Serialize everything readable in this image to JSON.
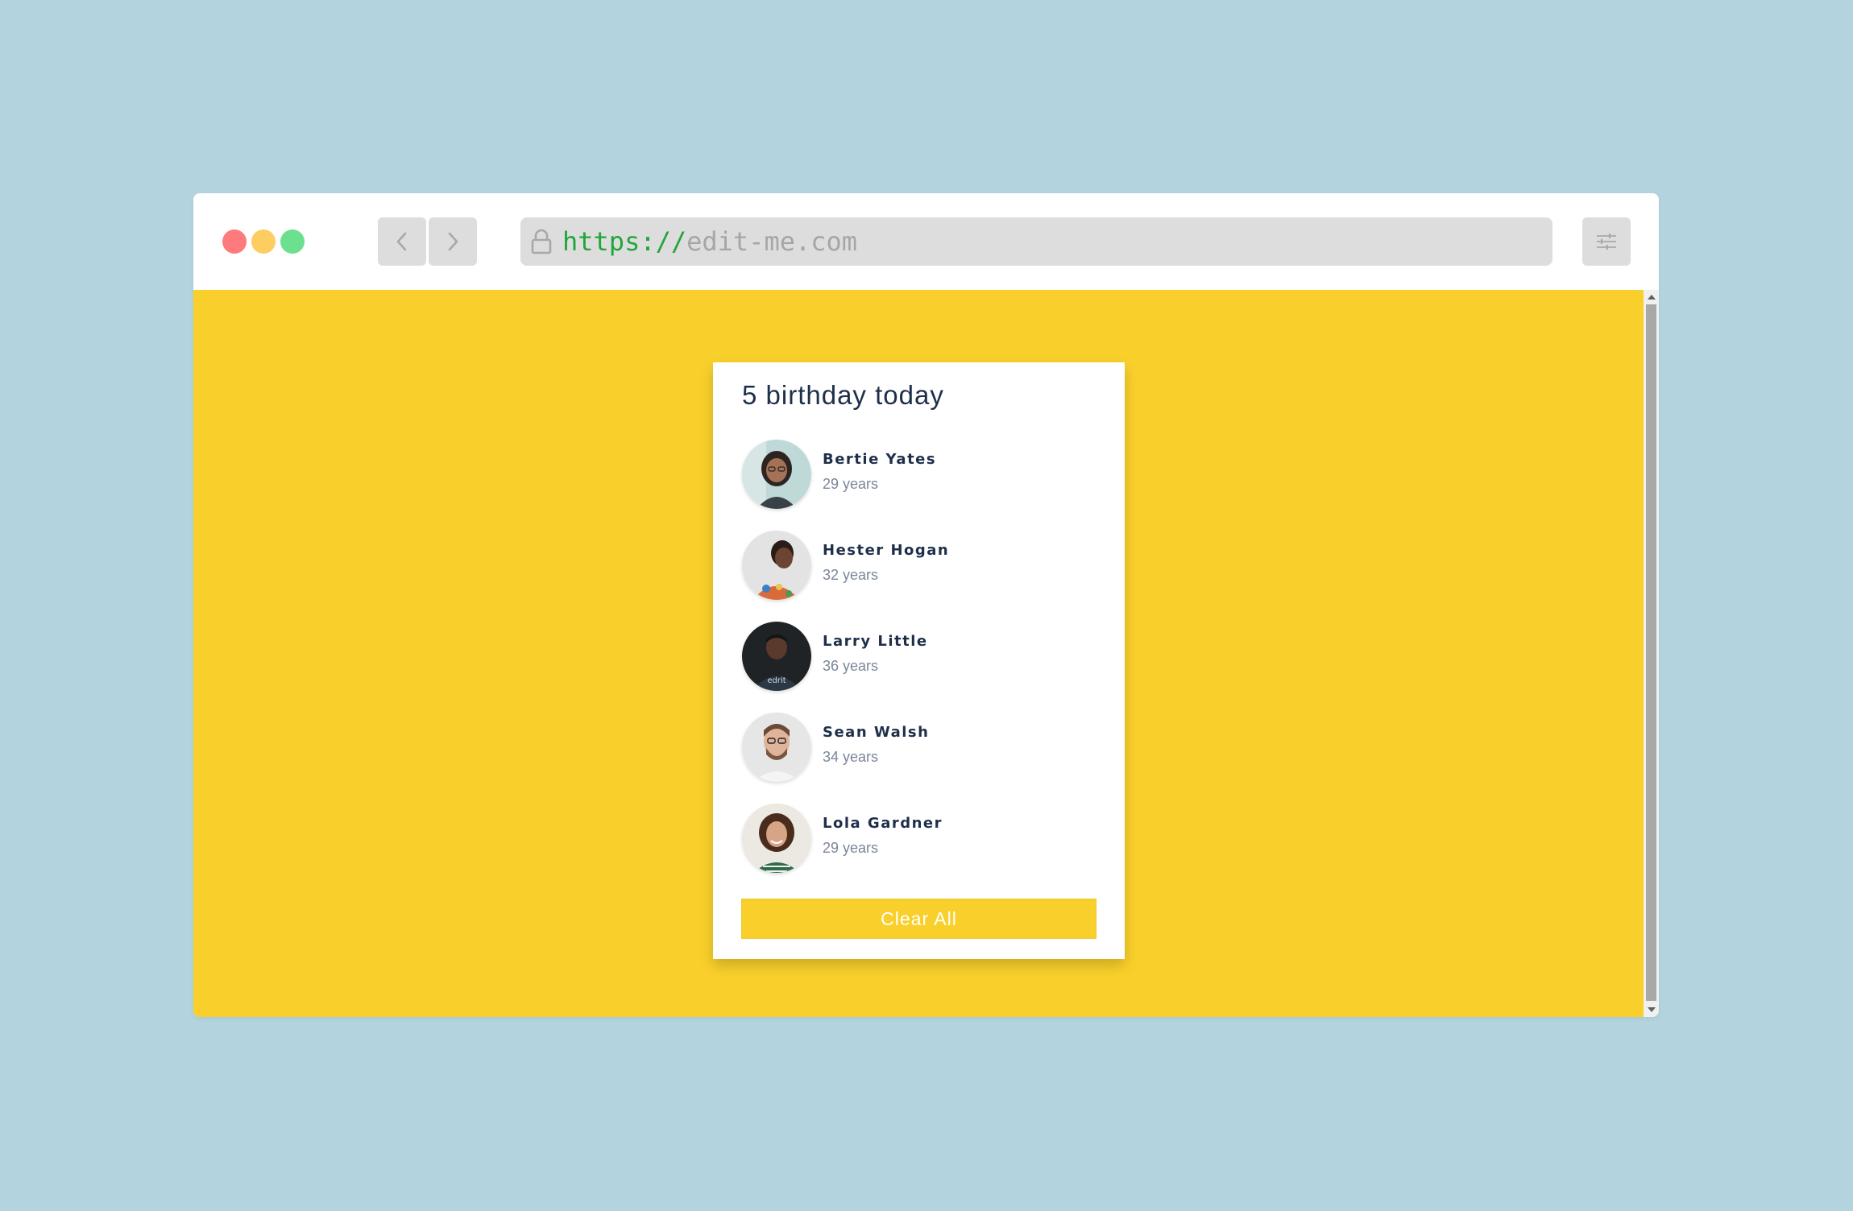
{
  "browser": {
    "url_scheme": "https://",
    "url_host": "edit-me.com",
    "colors": {
      "close": "#fe7a7c",
      "minimize": "#fdcd62",
      "maximize": "#6be08f",
      "url_scheme": "#22a63a"
    },
    "icons": [
      "chevron-left-icon",
      "chevron-right-icon",
      "lock-icon",
      "sliders-icon"
    ]
  },
  "page": {
    "background": "#f9d02b",
    "title": "5 birthday today",
    "people": [
      {
        "name": "Bertie Yates",
        "age": "29 years"
      },
      {
        "name": "Hester Hogan",
        "age": "32 years"
      },
      {
        "name": "Larry Little",
        "age": "36 years"
      },
      {
        "name": "Sean Walsh",
        "age": "34 years"
      },
      {
        "name": "Lola Gardner",
        "age": "29 years"
      }
    ],
    "clear_label": "Clear All"
  }
}
